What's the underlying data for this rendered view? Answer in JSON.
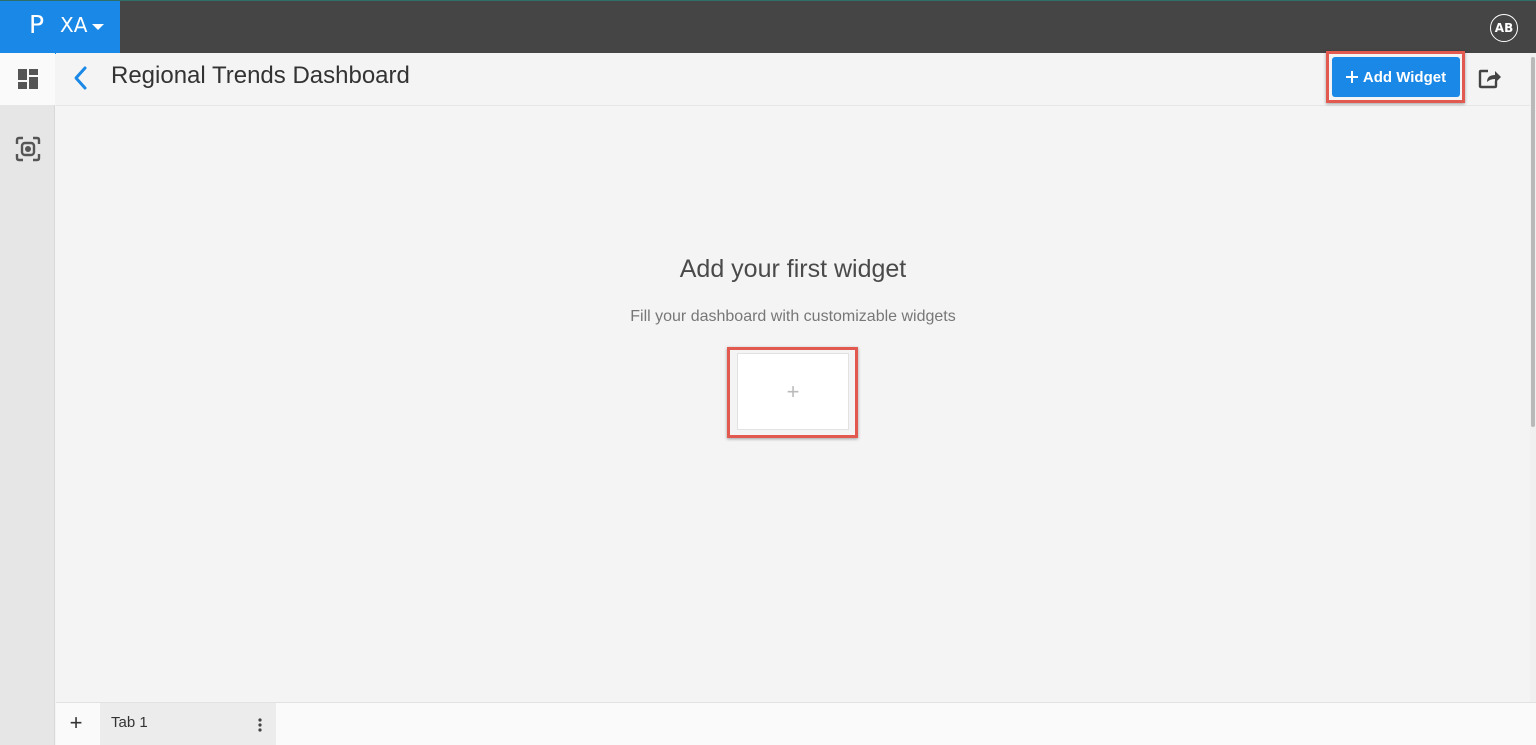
{
  "app": {
    "logo_glyph": "P",
    "name": "XA",
    "user_initials": "AB"
  },
  "header": {
    "title": "Regional Trends Dashboard",
    "add_widget_label": "Add Widget"
  },
  "empty_state": {
    "title": "Add your first widget",
    "subtitle": "Fill your dashboard with customizable widgets",
    "tile_plus": "+"
  },
  "tabs": {
    "add_label": "+",
    "items": [
      {
        "label": "Tab 1"
      }
    ]
  },
  "icons": {
    "rail": [
      "dashboard-icon",
      "scan-icon"
    ],
    "header": [
      "back-chevron-icon",
      "plus-icon",
      "share-icon"
    ],
    "tab": [
      "kebab-menu-icon"
    ]
  },
  "colors": {
    "brand_blue": "#1a88e6",
    "topbar": "#454545",
    "highlight_frame": "#e25a4f"
  }
}
